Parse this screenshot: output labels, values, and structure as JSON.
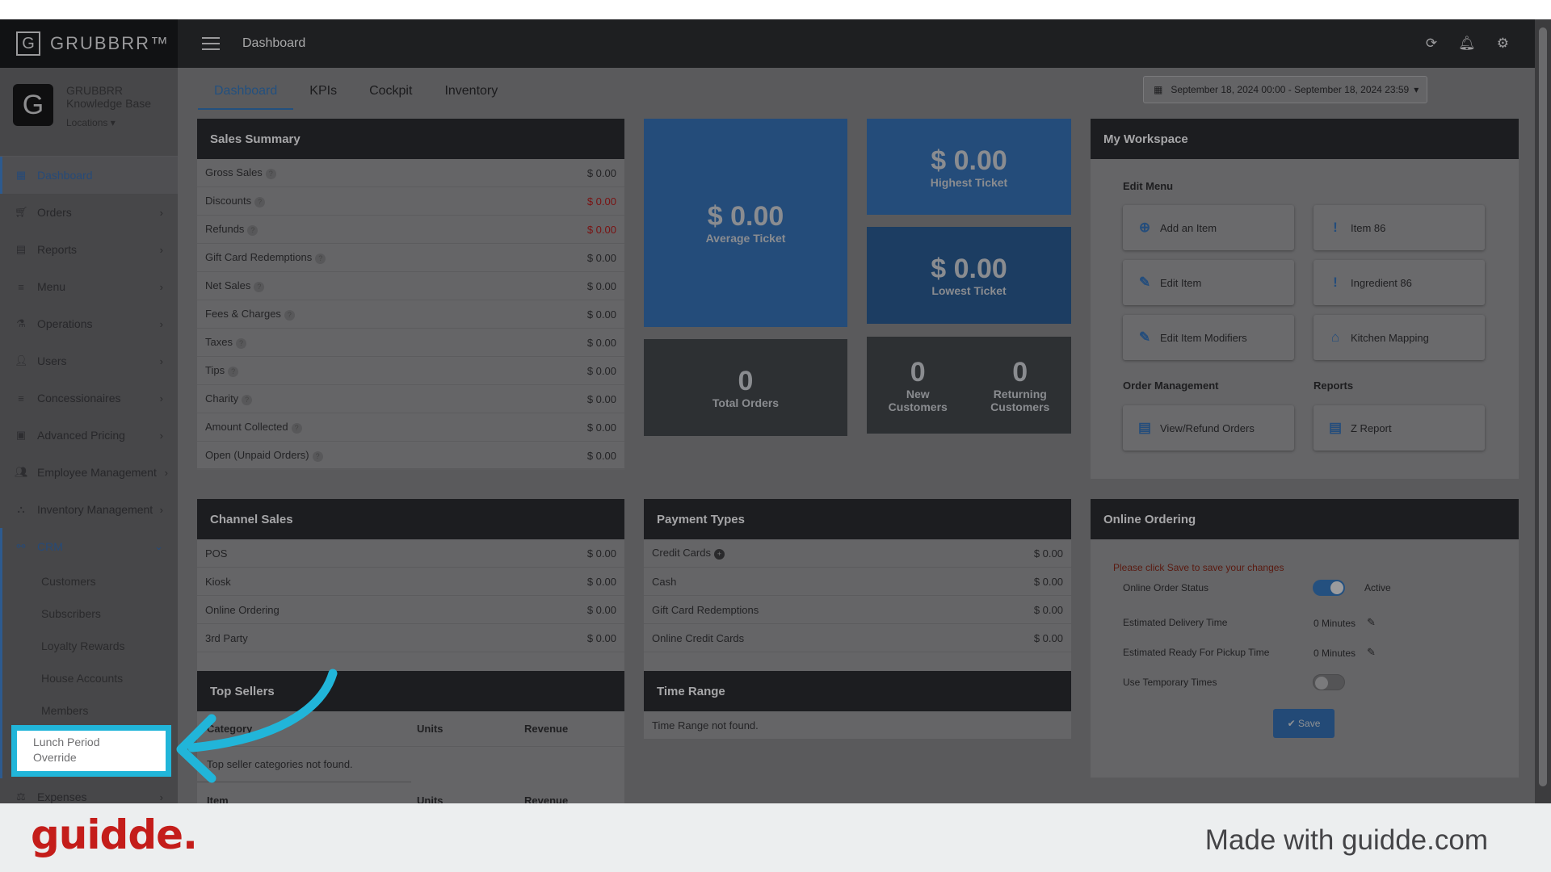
{
  "header": {
    "brand": "GRUBBRR™",
    "brand_mark": "G",
    "title": "Dashboard",
    "icons": [
      "refresh-icon",
      "bell-icon",
      "gear-icon"
    ]
  },
  "profile": {
    "avatar": "G",
    "name_line1": "GRUBBRR",
    "name_line2": "Knowledge Base",
    "locations": "Locations ▾"
  },
  "sidebar": {
    "items": [
      {
        "label": "Dashboard",
        "icon": "dashboard-icon"
      },
      {
        "label": "Orders",
        "icon": "cart-icon"
      },
      {
        "label": "Reports",
        "icon": "report-icon"
      },
      {
        "label": "Menu",
        "icon": "list-icon"
      },
      {
        "label": "Operations",
        "icon": "flask-icon"
      },
      {
        "label": "Users",
        "icon": "user-plus-icon"
      },
      {
        "label": "Concessionaires",
        "icon": "list-icon"
      },
      {
        "label": "Advanced Pricing",
        "icon": "money-icon"
      },
      {
        "label": "Employee Management",
        "icon": "users-icon"
      },
      {
        "label": "Inventory Management",
        "icon": "sitemap-icon"
      },
      {
        "label": "CRM",
        "icon": "crm-icon"
      }
    ],
    "crm_sub": [
      "Customers",
      "Subscribers",
      "Loyalty Rewards",
      "House Accounts",
      "Members"
    ],
    "highlight": "Lunch Period Override",
    "expenses": "Expenses"
  },
  "tabs": [
    "Dashboard",
    "KPIs",
    "Cockpit",
    "Inventory"
  ],
  "date_range": "September 18, 2024 00:00 - September 18, 2024 23:59",
  "sales_summary": {
    "title": "Sales Summary",
    "rows": [
      {
        "label": "Gross Sales",
        "value": "$ 0.00"
      },
      {
        "label": "Discounts",
        "value": "$ 0.00"
      },
      {
        "label": "Refunds",
        "value": "$ 0.00"
      },
      {
        "label": "Gift Card Redemptions",
        "value": "$ 0.00"
      },
      {
        "label": "Net Sales",
        "value": "$ 0.00"
      },
      {
        "label": "Fees & Charges",
        "value": "$ 0.00"
      },
      {
        "label": "Taxes",
        "value": "$ 0.00"
      },
      {
        "label": "Tips",
        "value": "$ 0.00"
      },
      {
        "label": "Charity",
        "value": "$ 0.00"
      },
      {
        "label": "Amount Collected",
        "value": "$ 0.00"
      },
      {
        "label": "Open (Unpaid Orders)",
        "value": "$ 0.00"
      }
    ]
  },
  "tiles": {
    "average_ticket": {
      "value": "$ 0.00",
      "label": "Average Ticket"
    },
    "highest_ticket": {
      "value": "$ 0.00",
      "label": "Highest Ticket"
    },
    "lowest_ticket": {
      "value": "$ 0.00",
      "label": "Lowest Ticket"
    },
    "total_orders": {
      "value": "0",
      "label": "Total Orders"
    },
    "new_customers": {
      "value": "0",
      "label_1": "New",
      "label_2": "Customers"
    },
    "returning_customers": {
      "value": "0",
      "label_1": "Returning",
      "label_2": "Customers"
    }
  },
  "workspace": {
    "title": "My Workspace",
    "edit_menu": "Edit Menu",
    "order_management": "Order Management",
    "reports": "Reports",
    "buttons": {
      "add_item": "Add an Item",
      "item86": "Item 86",
      "edit_item": "Edit Item",
      "ingredient86": "Ingredient 86",
      "edit_modifiers": "Edit Item Modifiers",
      "kitchen_mapping": "Kitchen Mapping",
      "view_refund": "View/Refund Orders",
      "z_report": "Z Report"
    }
  },
  "channel_sales": {
    "title": "Channel Sales",
    "rows": [
      {
        "label": "POS",
        "value": "$ 0.00"
      },
      {
        "label": "Kiosk",
        "value": "$ 0.00"
      },
      {
        "label": "Online Ordering",
        "value": "$ 0.00"
      },
      {
        "label": "3rd Party",
        "value": "$ 0.00"
      }
    ]
  },
  "payment_types": {
    "title": "Payment Types",
    "rows": [
      {
        "label": "Credit Cards",
        "value": "$ 0.00"
      },
      {
        "label": "Cash",
        "value": "$ 0.00"
      },
      {
        "label": "Gift Card Redemptions",
        "value": "$ 0.00"
      },
      {
        "label": "Online Credit Cards",
        "value": "$ 0.00"
      }
    ]
  },
  "online_ordering": {
    "title": "Online Ordering",
    "warning": "Please click Save to save your changes",
    "status_label": "Online Order Status",
    "status_value": "Active",
    "delivery_label": "Estimated Delivery Time",
    "delivery_value": "0 Minutes",
    "pickup_label": "Estimated Ready For Pickup Time",
    "pickup_value": "0 Minutes",
    "temp_label": "Use Temporary Times",
    "save": "✔ Save"
  },
  "top_sellers": {
    "title": "Top Sellers",
    "col_category": "Category",
    "col_units": "Units",
    "col_revenue": "Revenue",
    "empty": "Top seller categories not found.",
    "col_item": "Item"
  },
  "time_range": {
    "title": "Time Range",
    "empty": "Time Range not found."
  },
  "footer": {
    "brand": "guidde.",
    "made_with": "Made with guidde.com"
  },
  "colors": {
    "accent": "#21b5d9",
    "brand_red": "#c41d1a",
    "header": "#1e1f21"
  }
}
